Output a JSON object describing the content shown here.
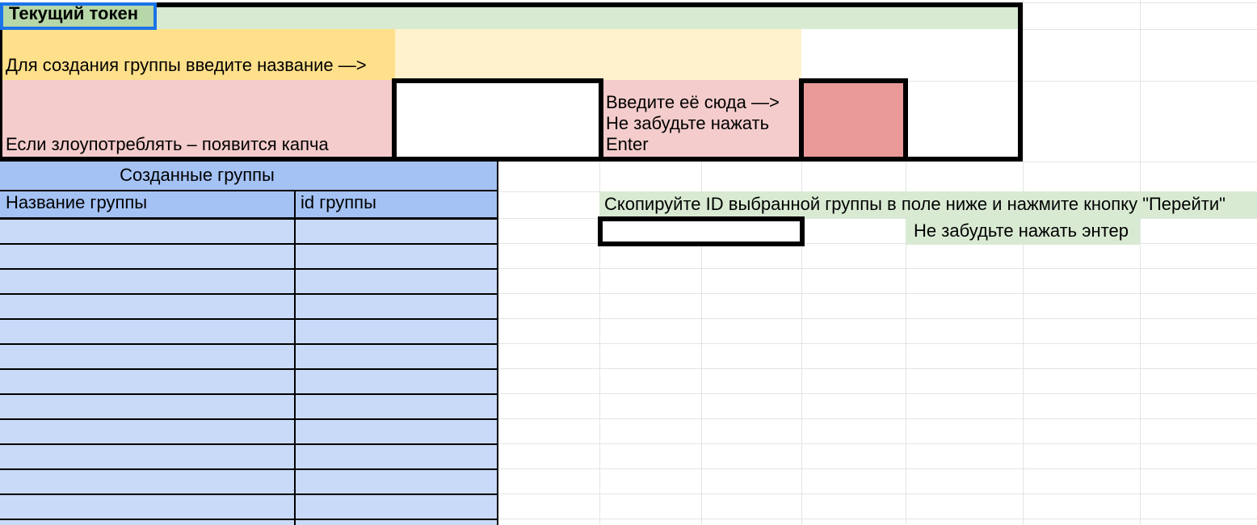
{
  "sheet": {
    "token_section": {
      "current_token_label": "Текущий токен",
      "create_group_hint": "Для создания группы введите название —>",
      "group_name_input_value": "",
      "captcha_warning": "Если злоупотреблять – появится капча",
      "captcha_input_value": "",
      "captcha_hint_lines": [
        "Введите её сюда —>",
        "Не забудьте нажать",
        "Enter"
      ]
    },
    "groups_table": {
      "title": "Созданные группы",
      "columns": [
        "Название группы",
        "id группы"
      ],
      "rows": [
        [
          "",
          ""
        ],
        [
          "",
          ""
        ],
        [
          "",
          ""
        ],
        [
          "",
          ""
        ],
        [
          "",
          ""
        ],
        [
          "",
          ""
        ],
        [
          "",
          ""
        ],
        [
          "",
          ""
        ],
        [
          "",
          ""
        ],
        [
          "",
          ""
        ],
        [
          "",
          ""
        ],
        [
          "",
          ""
        ]
      ]
    },
    "navigate_section": {
      "copy_id_instruction": "Скопируйте ID выбранной группы в поле ниже и нажмите кнопку \"Перейти\"",
      "group_id_input_value": "",
      "press_enter_reminder": "Не забудьте нажать энтер"
    },
    "colors": {
      "selected_cell_fill": "#b6d7a8",
      "header_row_green": "#d9ead3",
      "hint_yellow": "#ffe08a",
      "input_yellow": "#fff2cc",
      "warning_pink": "#f4cccc",
      "captcha_red": "#ea9999",
      "table_header_blue": "#a4c2f4",
      "table_row_blue": "#c9daf8",
      "selection_border_blue": "#1a73e8"
    }
  }
}
